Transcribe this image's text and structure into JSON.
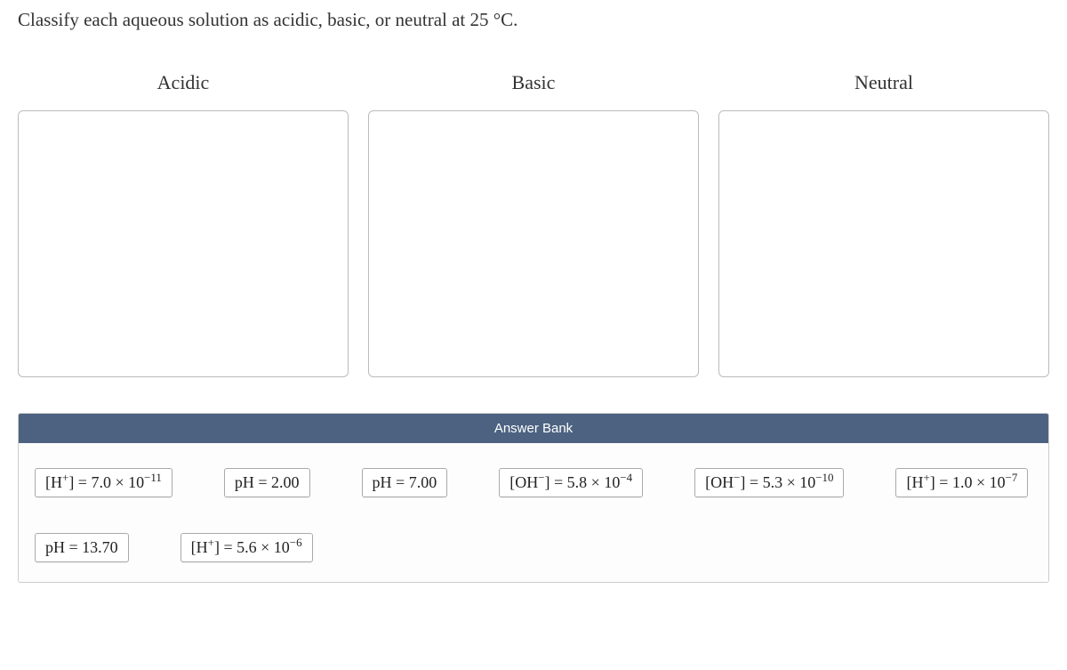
{
  "question": "Classify each aqueous solution as acidic, basic, or neutral at 25 °C.",
  "categories": {
    "acidic": "Acidic",
    "basic": "Basic",
    "neutral": "Neutral"
  },
  "answerBank": {
    "header": "Answer Bank",
    "items": [
      {
        "html": "[H<sup>+</sup>] = 7.0 × 10<sup>−11</sup>"
      },
      {
        "html": "pH = 2.00"
      },
      {
        "html": "pH = 7.00"
      },
      {
        "html": "[OH<sup>−</sup>] = 5.8 × 10<sup>−4</sup>"
      },
      {
        "html": "[OH<sup>−</sup>] = 5.3 × 10<sup>−10</sup>"
      },
      {
        "html": "[H<sup>+</sup>] = 1.0 × 10<sup>−7</sup>"
      },
      {
        "html": "pH = 13.70"
      },
      {
        "html": "[H<sup>+</sup>] = 5.6 × 10<sup>−6</sup>"
      }
    ]
  }
}
